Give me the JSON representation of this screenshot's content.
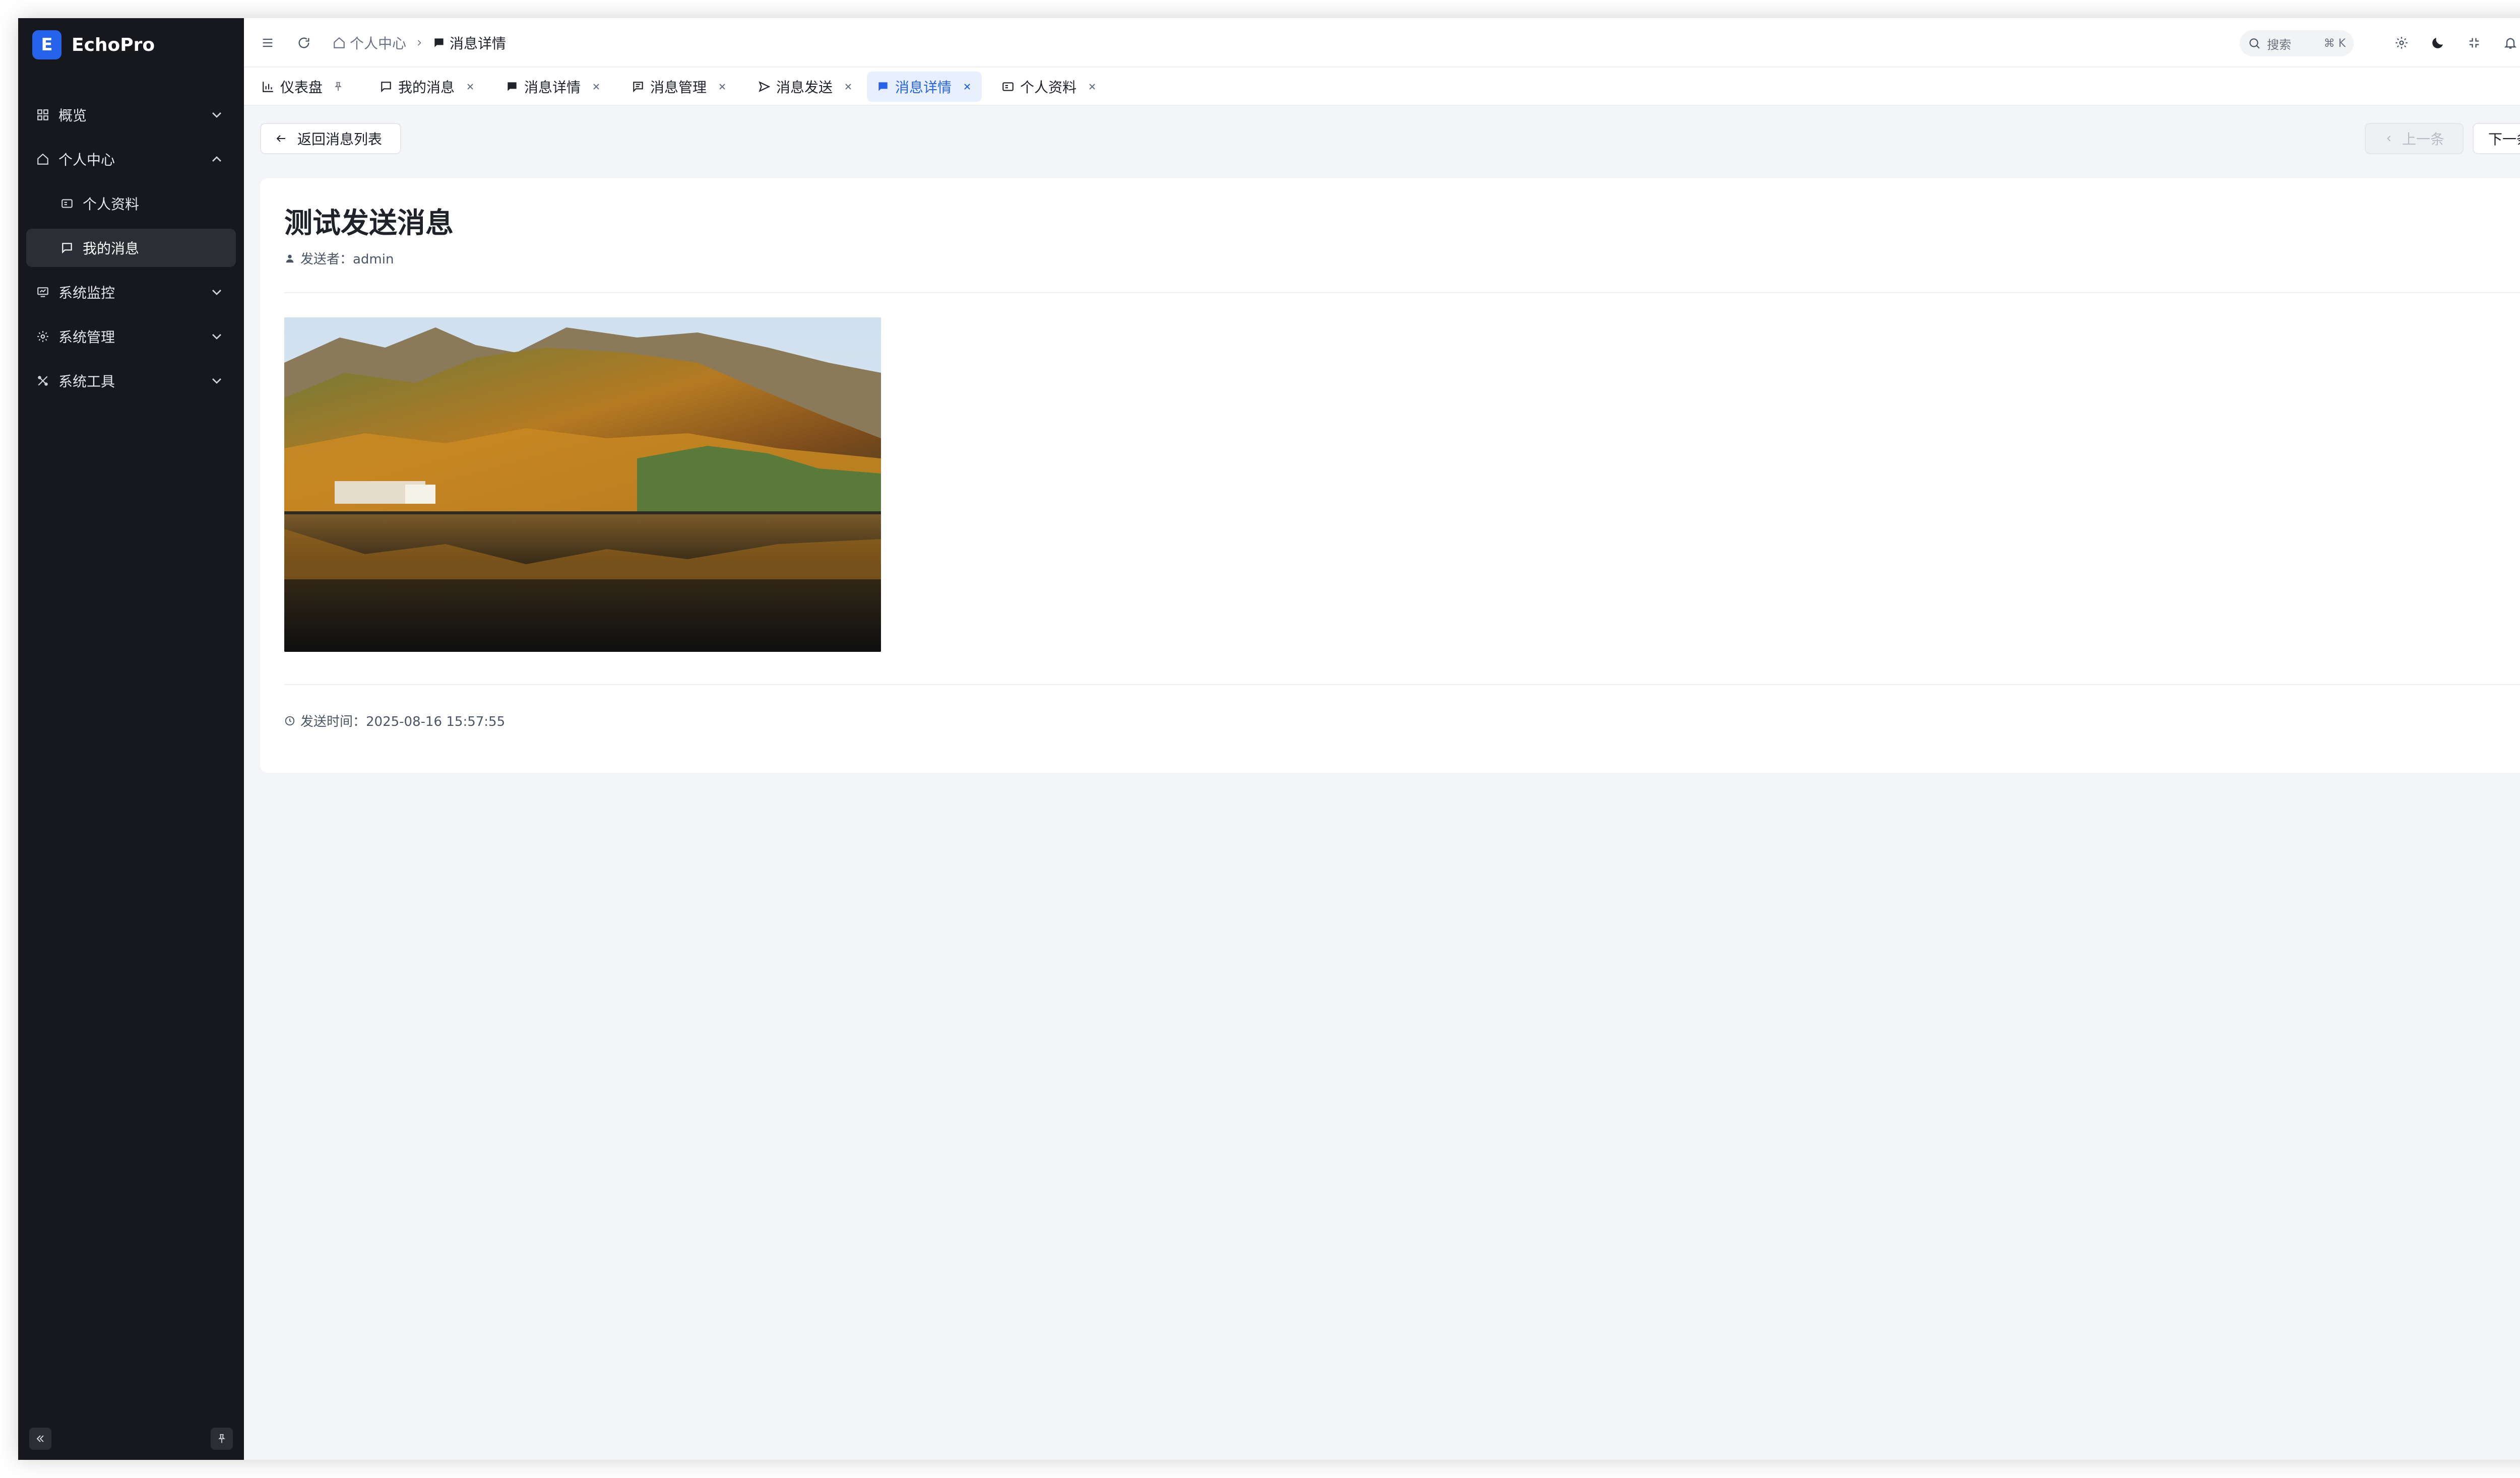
{
  "app": {
    "name": "EchoPro"
  },
  "sidebar": {
    "items": [
      {
        "label": "概览",
        "icon": "grid-icon"
      },
      {
        "label": "个人中心",
        "icon": "home-icon"
      },
      {
        "label": "个人资料",
        "icon": "id-card-icon"
      },
      {
        "label": "我的消息",
        "icon": "message-icon"
      },
      {
        "label": "系统监控",
        "icon": "monitor-icon"
      },
      {
        "label": "系统管理",
        "icon": "gear-icon"
      },
      {
        "label": "系统工具",
        "icon": "tools-icon"
      }
    ]
  },
  "header": {
    "breadcrumb": [
      "个人中心",
      "消息详情"
    ],
    "search_placeholder": "搜索",
    "search_shortcut": "⌘ K"
  },
  "tabs": [
    {
      "label": "仪表盘"
    },
    {
      "label": "我的消息"
    },
    {
      "label": "消息详情"
    },
    {
      "label": "消息管理"
    },
    {
      "label": "消息发送"
    },
    {
      "label": "消息详情"
    },
    {
      "label": "个人资料"
    }
  ],
  "toolbar": {
    "back_label": "返回消息列表",
    "prev_label": "上一条",
    "next_label": "下一条"
  },
  "message": {
    "title": "测试发送消息",
    "sender_label": "发送者：admin",
    "sent_time_label": "发送时间：2025-08-16 15:57:55"
  },
  "colors": {
    "sidebar_bg": "#16181d",
    "accent": "#2563eb",
    "page_bg": "#f4f5f8"
  }
}
